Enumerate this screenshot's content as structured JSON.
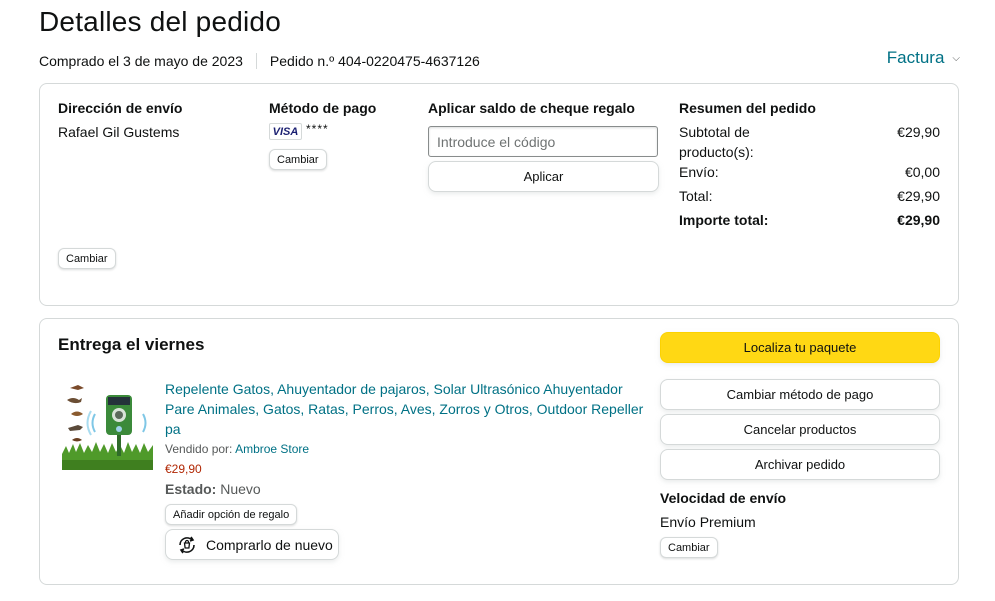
{
  "header": {
    "title": "Detalles del pedido",
    "purchase_date": "Comprado el 3 de mayo de 2023",
    "order_number": "Pedido n.º 404-0220475-4637126",
    "invoice_label": "Factura"
  },
  "shipping": {
    "title": "Dirección de envío",
    "name": "Rafael Gil Gustems",
    "change_label": "Cambiar"
  },
  "payment": {
    "title": "Método de pago",
    "card_brand": "VISA",
    "card_masked": "****",
    "change_label": "Cambiar"
  },
  "gift_card": {
    "title": "Aplicar saldo de cheque regalo",
    "placeholder": "Introduce el código",
    "apply_label": "Aplicar"
  },
  "summary": {
    "title": "Resumen del pedido",
    "rows": [
      {
        "label": "Subtotal de producto(s):",
        "value": "€29,90"
      },
      {
        "label": "Envío:",
        "value": "€0,00"
      },
      {
        "label": "Total:",
        "value": "€29,90"
      },
      {
        "label": "Importe total:",
        "value": "€29,90"
      }
    ]
  },
  "delivery": {
    "title": "Entrega el viernes",
    "product_title": "Repelente Gatos, Ahuyentador de pajaros, Solar Ultrasónico Ahuyentador Pare Animales, Gatos, Ratas, Perros, Aves, Zorros y Otros, Outdoor Repeller pa",
    "sold_by_label": "Vendido por:",
    "seller": "Ambroe Store",
    "price": "€29,90",
    "status_label": "Estado:",
    "status_value": "Nuevo",
    "gift_option_label": "Añadir opción de regalo",
    "buy_again_label": "Comprarlo de nuevo"
  },
  "actions": {
    "track_label": "Localiza tu paquete",
    "change_payment_label": "Cambiar método de pago",
    "cancel_label": "Cancelar productos",
    "archive_label": "Archivar pedido",
    "shipping_speed_title": "Velocidad de envío",
    "shipping_speed_value": "Envío Premium",
    "change_label": "Cambiar"
  },
  "colors": {
    "link": "#007185",
    "price": "#b12704",
    "primary_button": "#ffd814",
    "border": "#d5d9d9"
  }
}
